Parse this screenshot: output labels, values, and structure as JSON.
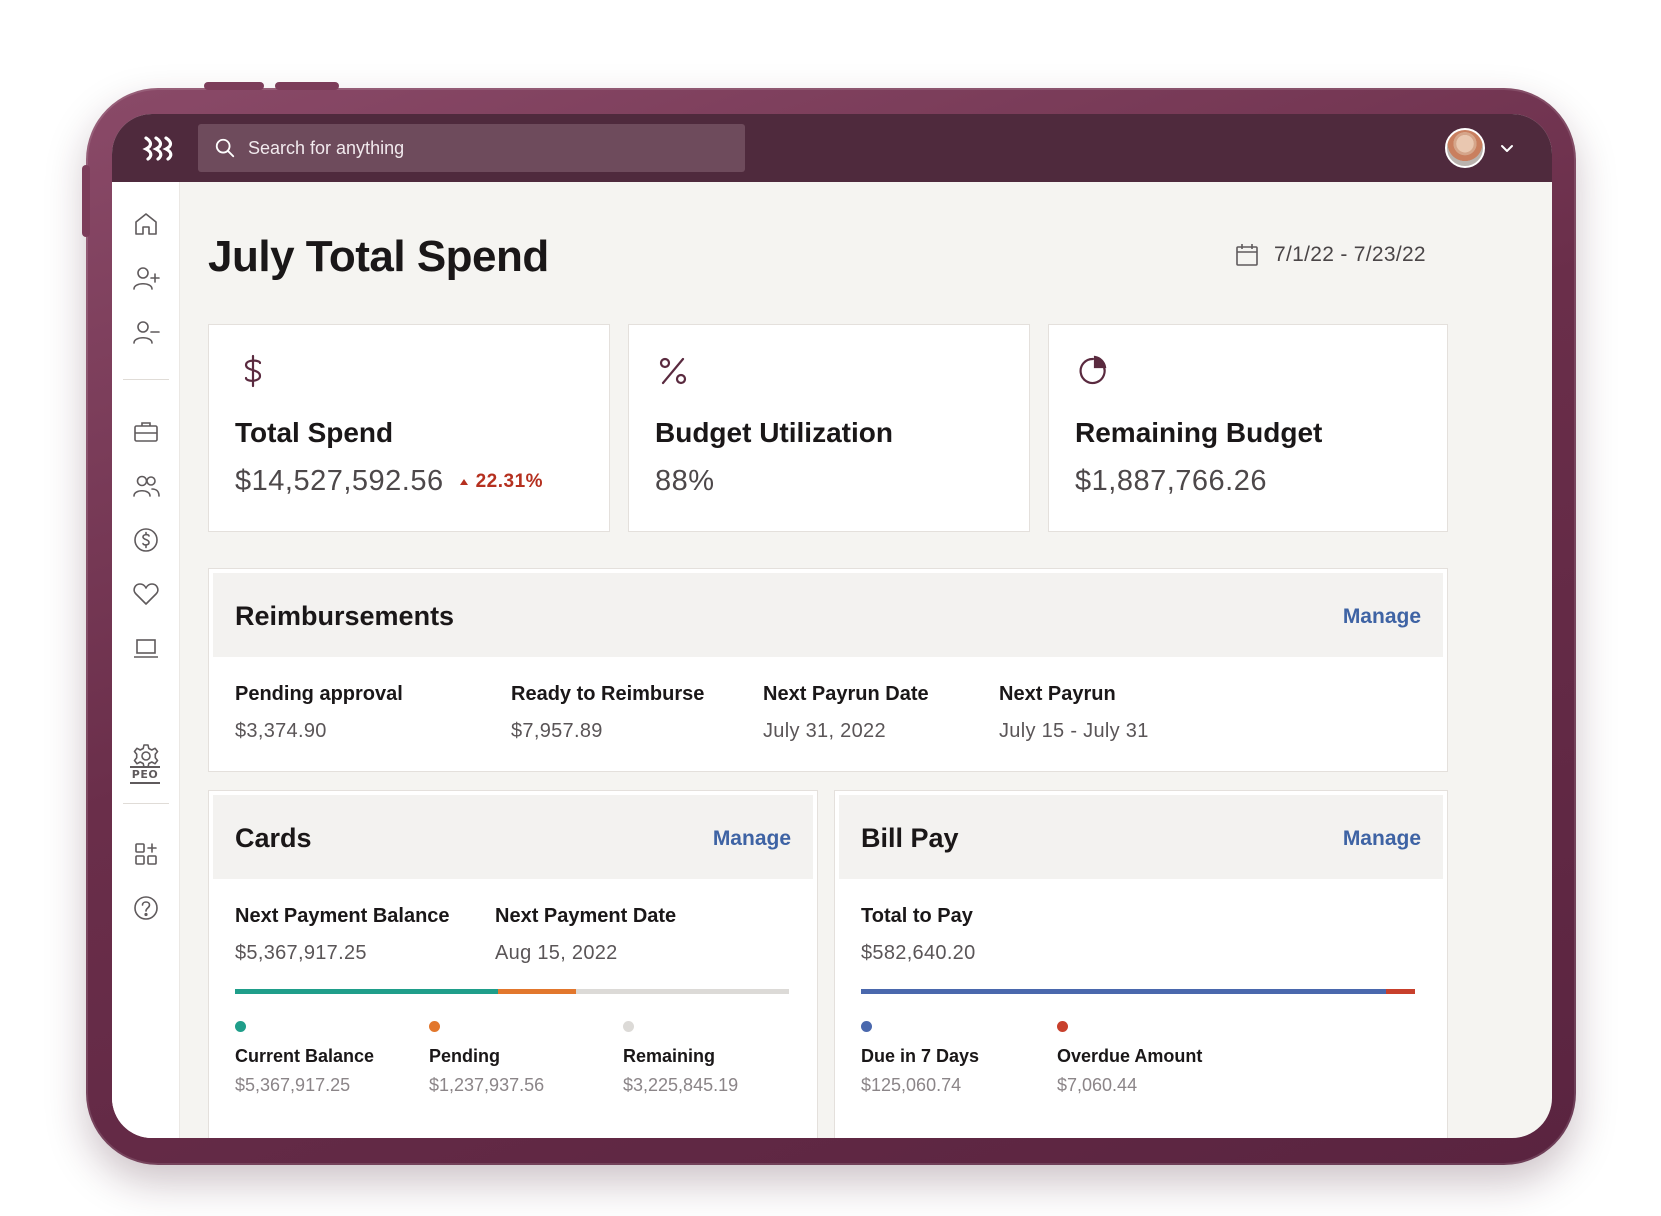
{
  "search": {
    "placeholder": "Search for anything"
  },
  "page": {
    "title": "July Total Spend",
    "date_range": "7/1/22 - 7/23/22"
  },
  "kpis": [
    {
      "icon": "dollar-icon",
      "title": "Total Spend",
      "value": "$14,527,592.56",
      "delta": "22.31%"
    },
    {
      "icon": "percent-icon",
      "title": "Budget Utilization",
      "value": "88%"
    },
    {
      "icon": "pie-chart-icon",
      "title": "Remaining Budget",
      "value": "$1,887,766.26"
    }
  ],
  "reimbursements": {
    "title": "Reimbursements",
    "manage_label": "Manage",
    "stats": [
      {
        "label": "Pending approval",
        "value": "$3,374.90"
      },
      {
        "label": "Ready to Reimburse",
        "value": "$7,957.89"
      },
      {
        "label": "Next Payrun Date",
        "value": "July 31, 2022"
      },
      {
        "label": "Next Payrun",
        "value": "July 15 - July 31"
      }
    ]
  },
  "cards": {
    "title": "Cards",
    "manage_label": "Manage",
    "stats": [
      {
        "label": "Next Payment Balance",
        "value": "$5,367,917.25"
      },
      {
        "label": "Next Payment Date",
        "value": "Aug 15, 2022"
      }
    ],
    "bar_segments": [
      {
        "name": "Current Balance",
        "fraction": 0.475,
        "color": "#1f9e8a"
      },
      {
        "name": "Pending",
        "fraction": 0.14,
        "color": "#e2772d"
      },
      {
        "name": "Remaining",
        "fraction": 0.385,
        "color": "#dcdad7"
      }
    ],
    "legend": [
      {
        "label": "Current Balance",
        "color": "#1f9e8a",
        "value": "$5,367,917.25"
      },
      {
        "label": "Pending",
        "color": "#e2772d",
        "value": "$1,237,937.56"
      },
      {
        "label": "Remaining",
        "color": "#dcdad7",
        "value": "$3,225,845.19"
      }
    ]
  },
  "bill_pay": {
    "title": "Bill Pay",
    "manage_label": "Manage",
    "stats": [
      {
        "label": "Total to Pay",
        "value": "$582,640.20"
      }
    ],
    "bar_segments": [
      {
        "name": "Due in 7 Days",
        "fraction": 0.948,
        "color": "#4a68ad"
      },
      {
        "name": "Overdue Amount",
        "fraction": 0.052,
        "color": "#c8402c"
      }
    ],
    "legend": [
      {
        "label": "Due in 7 Days",
        "color": "#4a68ad",
        "value": "$125,060.74"
      },
      {
        "label": "Overdue Amount",
        "color": "#c8402c",
        "value": "$7,060.44"
      }
    ]
  },
  "colors": {
    "topbar": "#4f2a3d",
    "link": "#3e63a4",
    "negative": "#b5301f"
  }
}
